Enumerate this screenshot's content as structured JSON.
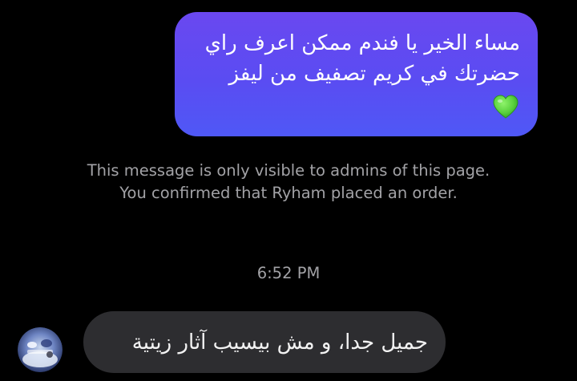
{
  "messages": {
    "outgoing": {
      "text": "مساء الخير يا فندم ممكن اعرف راي\nحضرتك في كريم تصفيف من ليفز",
      "emoji_icon": "green-heart-icon"
    },
    "admin_notice": "This message is only visible to admins of this page. You confirmed that Ryham placed an order.",
    "timestamp": "6:52 PM",
    "incoming": {
      "text": "جميل جدا، و مش بيسيب آثار زيتية",
      "avatar_icon": "avatar-image"
    }
  },
  "colors": {
    "background": "#000000",
    "outgoing_bubble": "#5a4cf2",
    "incoming_bubble": "#2d2d30",
    "muted_text": "#a2a2a6",
    "heart": "#5ad13e"
  }
}
